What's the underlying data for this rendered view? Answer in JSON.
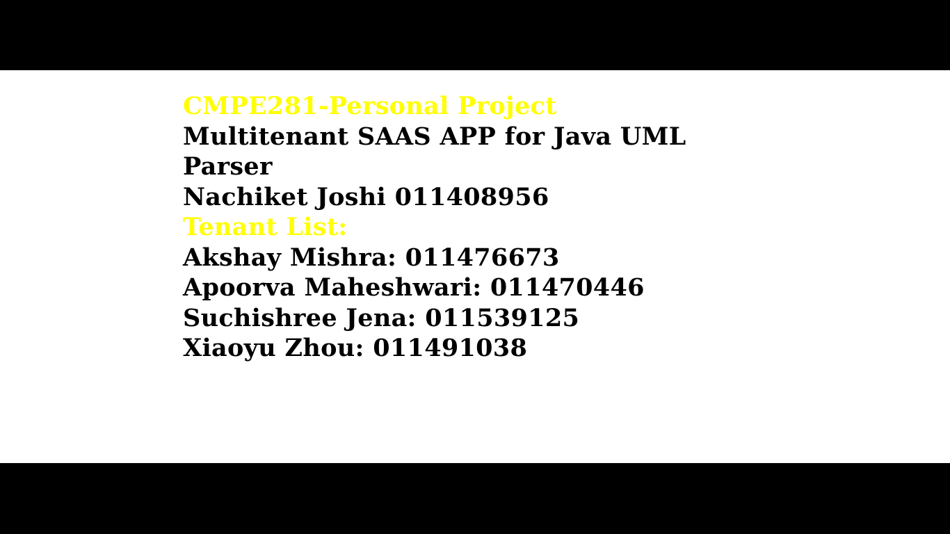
{
  "header": {
    "project_title": "CMPE281-Personal Project",
    "app_description": "Multitenant SAAS APP for Java UML Parser",
    "author": "Nachiket Joshi 011408956"
  },
  "tenants": {
    "heading": "Tenant List:",
    "items": [
      "Akshay Mishra: 011476673",
      "Apoorva Maheshwari: 011470446",
      "Suchishree Jena: 011539125",
      "Xiaoyu Zhou: 011491038"
    ]
  },
  "colors": {
    "accent": "#ffff00",
    "text": "#000000",
    "background": "#ffffff",
    "letterbox": "#000000"
  }
}
